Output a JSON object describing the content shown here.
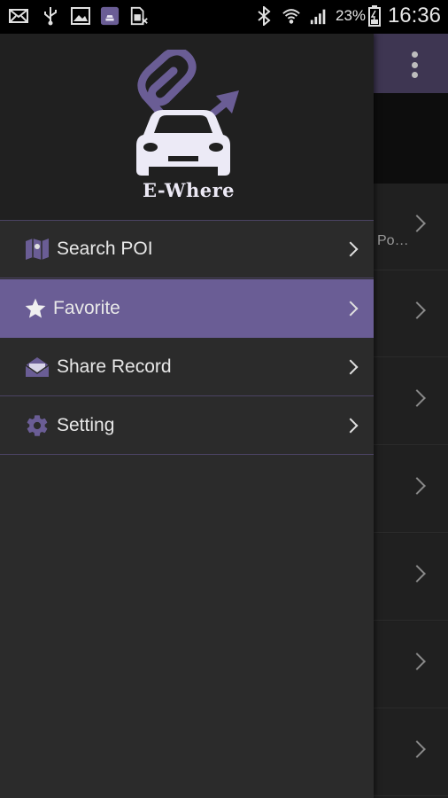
{
  "status_bar": {
    "battery_percent": "23%",
    "time": "16:36",
    "icons": [
      "mail-icon",
      "usb-icon",
      "image-icon",
      "app-notification-icon",
      "sim-icon",
      "bluetooth-icon",
      "wifi-icon",
      "signal-icon",
      "battery-icon"
    ]
  },
  "drawer": {
    "app_name": "E-Where",
    "menu": [
      {
        "label": "Search POI",
        "icon": "map-icon",
        "active": false
      },
      {
        "label": "Favorite",
        "icon": "star-icon",
        "active": true
      },
      {
        "label": "Share Record",
        "icon": "mail-open-icon",
        "active": false
      },
      {
        "label": "Setting",
        "icon": "gear-icon",
        "active": false
      }
    ]
  },
  "background_list": {
    "first_row_text": "Po…"
  },
  "colors": {
    "accent": "#6a5d95",
    "toolbar": "#3e3652",
    "drawer_bg": "#2b2b2b"
  }
}
